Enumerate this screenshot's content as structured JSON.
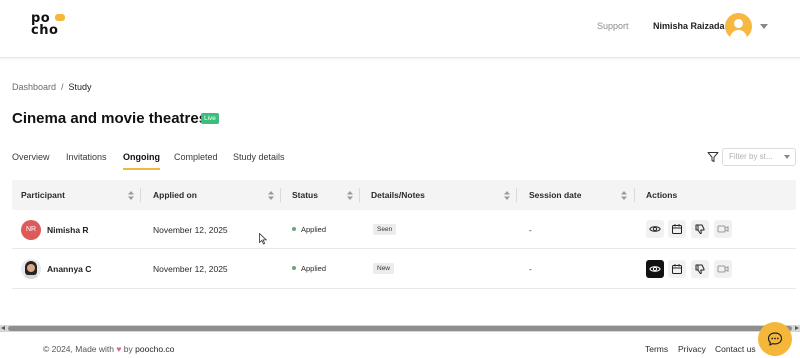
{
  "header": {
    "logo_line1": "po",
    "logo_line2": "cho",
    "support": "Support",
    "user_name": "Nimisha Raizada"
  },
  "breadcrumb": {
    "items": [
      "Dashboard",
      "Study"
    ],
    "separator": "/"
  },
  "page": {
    "title": "Cinema and movie theatres",
    "status_badge": "Live"
  },
  "tabs": [
    {
      "label": "Overview",
      "active": false
    },
    {
      "label": "Invitations",
      "active": false
    },
    {
      "label": "Ongoing",
      "active": true
    },
    {
      "label": "Completed",
      "active": false
    },
    {
      "label": "Study details",
      "active": false
    }
  ],
  "filter": {
    "placeholder": "Filter by st..."
  },
  "table": {
    "columns": [
      "Participant",
      "Applied on",
      "Status",
      "Details/Notes",
      "Session date",
      "Actions"
    ],
    "rows": [
      {
        "initials": "NR",
        "name": "Nimisha R",
        "applied_on": "November 12, 2025",
        "status": "Applied",
        "note": "Seen",
        "session_date": "-"
      },
      {
        "initials": "",
        "name": "Anannya C",
        "applied_on": "November 12, 2025",
        "status": "Applied",
        "note": "New",
        "session_date": "-"
      }
    ]
  },
  "footer": {
    "copyright": "© 2024, Made with",
    "heart": "♥",
    "by": "by",
    "brand": "poocho.co",
    "links": [
      "Terms",
      "Privacy",
      "Contact us"
    ]
  },
  "colors": {
    "accent": "#f5b73a",
    "live": "#3cbd7b",
    "avatar_nr": "#dd5a5a"
  },
  "icons": {
    "actions": [
      "eye-icon",
      "calendar-icon",
      "thumbs-down-icon",
      "video-icon"
    ],
    "filter": "filter-icon",
    "chat": "chat-icon"
  }
}
